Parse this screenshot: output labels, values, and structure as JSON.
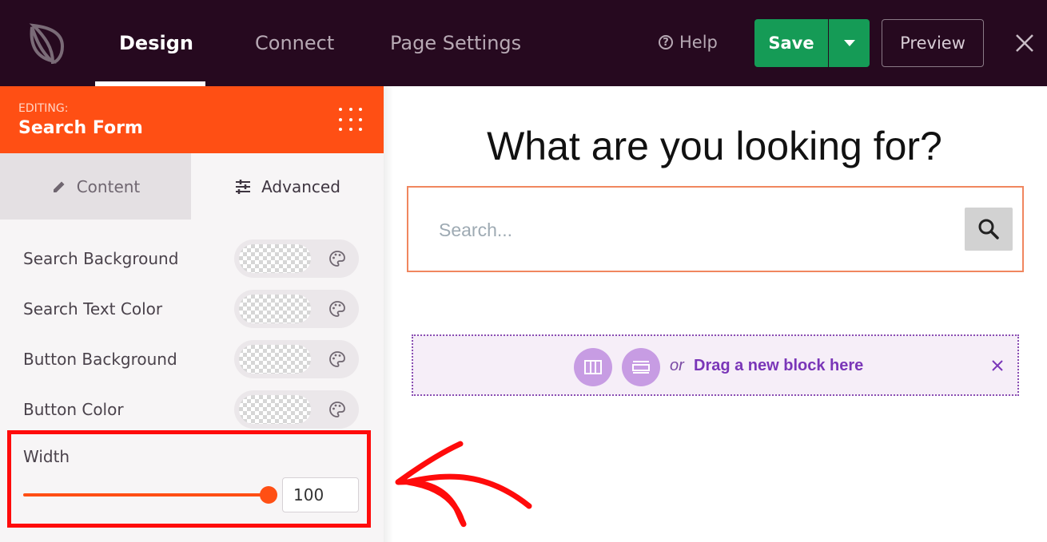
{
  "topbar": {
    "tabs": [
      {
        "label": "Design",
        "active": true
      },
      {
        "label": "Connect",
        "active": false
      },
      {
        "label": "Page Settings",
        "active": false
      }
    ],
    "help_label": "Help",
    "save_label": "Save",
    "preview_label": "Preview",
    "bg_color": "#26091f",
    "save_color": "#159b56"
  },
  "panel": {
    "editing_label": "EDITING:",
    "editing_name": "Search Form",
    "accent_color": "#ff4f14",
    "tabs": {
      "content": "Content",
      "advanced": "Advanced"
    },
    "rows": [
      {
        "label": "Search Background"
      },
      {
        "label": "Search Text Color"
      },
      {
        "label": "Button Background"
      },
      {
        "label": "Button Color"
      }
    ],
    "width": {
      "label": "Width",
      "value": "100",
      "slider_fraction": 1.0
    }
  },
  "canvas": {
    "headline": "What are you looking for?",
    "search_placeholder": "Search...",
    "dropzone": {
      "or_text": "or",
      "label": "Drag a new block here"
    }
  },
  "icons": [
    "logo-icon",
    "help-icon",
    "caret-down-icon",
    "close-icon",
    "pencil-icon",
    "sliders-icon",
    "palette-icon",
    "search-icon",
    "columns-icon",
    "rows-icon",
    "dots-grid-icon"
  ]
}
